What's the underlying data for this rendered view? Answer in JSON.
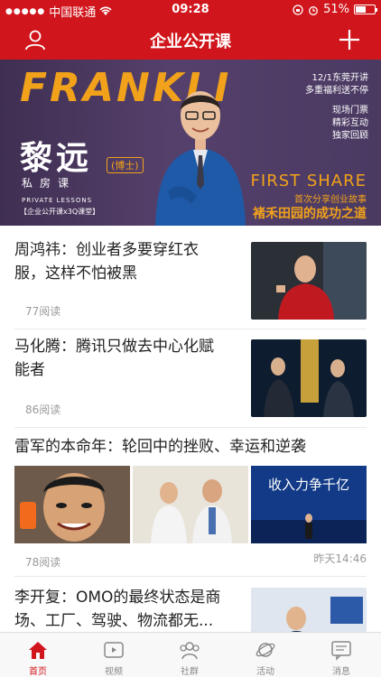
{
  "status": {
    "carrier": "中国联通",
    "time": "09:28",
    "battery": "51%"
  },
  "header": {
    "title": "企业公开课"
  },
  "banner": {
    "big_text": "FRANKLI",
    "right_lines": [
      "12/1东莞开讲",
      "多重福利送不停",
      "现场门票",
      "精彩互动",
      "独家回顾"
    ],
    "name": "黎远",
    "badge": "(博士)",
    "subtitle": "私房课",
    "private_lessons": "PRIVATE LESSONS",
    "bracket": "【企业公开课x3Q课堂】",
    "first_share": "FIRST SHARE",
    "first_share_sub": "首次分享创业故事",
    "slogan": "褚禾田园的成功之道"
  },
  "articles": [
    {
      "title_line1": "周鸿祎：创业者多要穿红衣",
      "title_line2": "服，这样不怕被黑",
      "reads": "77阅读"
    },
    {
      "title_line1": "马化腾：腾讯只做去中心化赋",
      "title_line2": "能者",
      "reads": "86阅读"
    },
    {
      "title_line1": "雷军的本命年：轮回中的挫败、幸运和逆袭",
      "reads": "78阅读",
      "time": "昨天14:46",
      "thumb3_text": "收入力争千亿"
    },
    {
      "title_line1": "李开复：OMO的最终状态是商",
      "title_line2": "场、工厂、驾驶、物流都无..."
    }
  ],
  "tabs": [
    {
      "label": "首页"
    },
    {
      "label": "视频"
    },
    {
      "label": "社群"
    },
    {
      "label": "活动"
    },
    {
      "label": "消息"
    }
  ],
  "colors": {
    "brand_red": "#d0161c",
    "accent_orange": "#f2a21a"
  }
}
